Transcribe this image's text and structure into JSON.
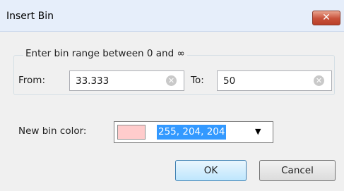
{
  "dialog": {
    "title": "Insert Bin",
    "close_glyph": "✕",
    "range_group_label": "Enter bin range between 0 and ∞",
    "from_label": "From:",
    "from_value": "33.333",
    "to_label": "To:",
    "to_value": "50",
    "color_label": "New bin color:",
    "color_value": "255, 204, 204",
    "swatch_color": "#ffcccc",
    "ok_label": "OK",
    "cancel_label": "Cancel",
    "clear_glyph": "✕",
    "dropdown_glyph": "▼"
  }
}
